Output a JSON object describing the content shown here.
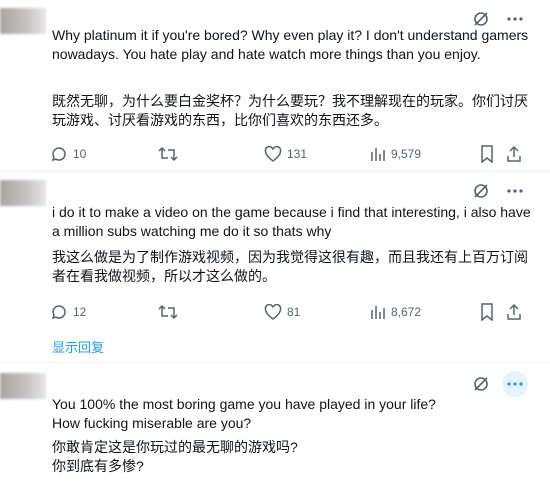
{
  "comments": [
    {
      "text_en": "Why platinum it if you're bored? Why even play it? I don't understand gamers nowadays. You hate play and hate watch more things than you enjoy.",
      "text_zh": "既然无聊，为什么要白金奖杯？为什么要玩？我不理解现在的玩家。你们讨厌玩游戏、讨厌看游戏的东西，比你们喜欢的东西还多。",
      "replies": "10",
      "likes": "131",
      "views": "9,579"
    },
    {
      "text_en": "i do it to make a video on the game because i find that interesting, i also have a million subs watching me do it so thats why",
      "text_zh": "我这么做是为了制作游戏视频，因为我觉得这很有趣，而且我还有上百万订阅者在看我做视频，所以才这么做的。",
      "replies": "12",
      "likes": "81",
      "views": "8,672"
    },
    {
      "text_en": "You 100% the most boring game you have played in your life?\nHow fucking miserable are you?",
      "text_zh": "你敢肯定这是你玩过的最无聊的游戏吗?\n你到底有多惨?"
    }
  ],
  "show_replies_label": "显示回复",
  "icons": {
    "grok": "grok-icon",
    "more": "more-icon",
    "reply": "reply-icon",
    "retweet": "retweet-icon",
    "like": "like-icon",
    "views": "views-icon",
    "bookmark": "bookmark-icon",
    "share": "share-icon"
  },
  "colors": {
    "link": "#1d9bf0",
    "muted": "#536471",
    "text": "#0f1419",
    "highlight": "#e6f3fd"
  }
}
